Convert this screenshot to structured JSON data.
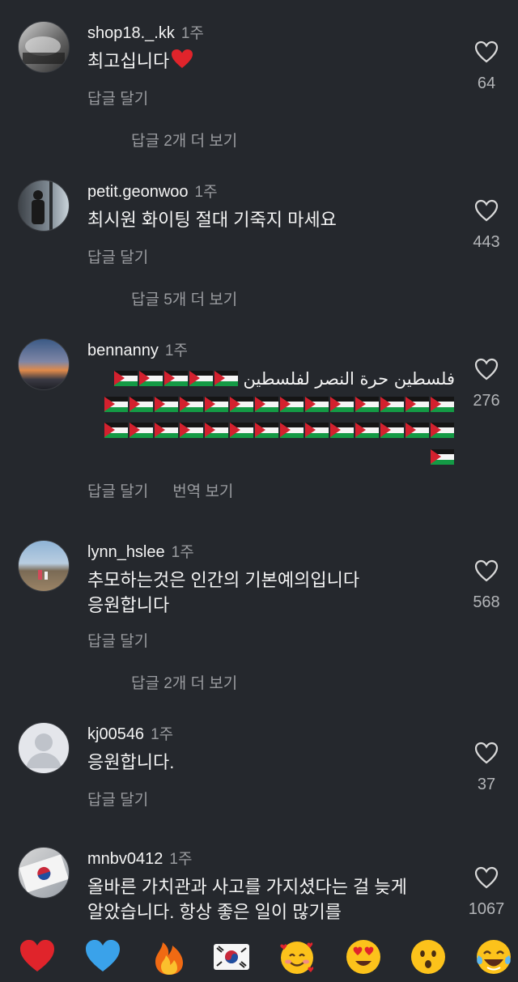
{
  "comments": [
    {
      "username": "shop18._.kk",
      "time": "1주",
      "text": "최고십니다",
      "likes": "64",
      "reply_label": "답글 달기",
      "view_replies": "답글 2개 더 보기"
    },
    {
      "username": "petit.geonwoo",
      "time": "1주",
      "text": "최시원 화이팅 절대 기죽지 마세요",
      "likes": "443",
      "reply_label": "답글 달기",
      "view_replies": "답글 5개 더 보기"
    },
    {
      "username": "bennanny",
      "time": "1주",
      "text": "فلسطين حرة النصر لفلسطين",
      "likes": "276",
      "reply_label": "답글 달기",
      "translate_label": "번역 보기"
    },
    {
      "username": "lynn_hslee",
      "time": "1주",
      "text_line1": "추모하는것은 인간의 기본예의입니다",
      "text_line2": "응원합니다",
      "likes": "568",
      "reply_label": "답글 달기",
      "view_replies": "답글 2개 더 보기"
    },
    {
      "username": "kj00546",
      "time": "1주",
      "text": "응원합니다.",
      "likes": "37",
      "reply_label": "답글 달기"
    },
    {
      "username": "mnbv0412",
      "time": "1주",
      "text_line1": "올바른 가치관과 사고를 가지셨다는 걸 늦게",
      "text_line2": "알았습니다. 항상 좋은 일이 많기를",
      "likes": "1067"
    }
  ],
  "icons": {
    "like": "heart-outline-icon",
    "emoji_bar": [
      "red-heart",
      "blue-heart",
      "fire",
      "korea-flag",
      "smiling-face-with-hearts",
      "heart-eyes",
      "hushed-face",
      "face-with-tears-of-joy"
    ]
  },
  "colors": {
    "background": "#25282d",
    "text": "#f2f2f2",
    "muted": "#9a9ca0",
    "heart": "#e0242b"
  }
}
